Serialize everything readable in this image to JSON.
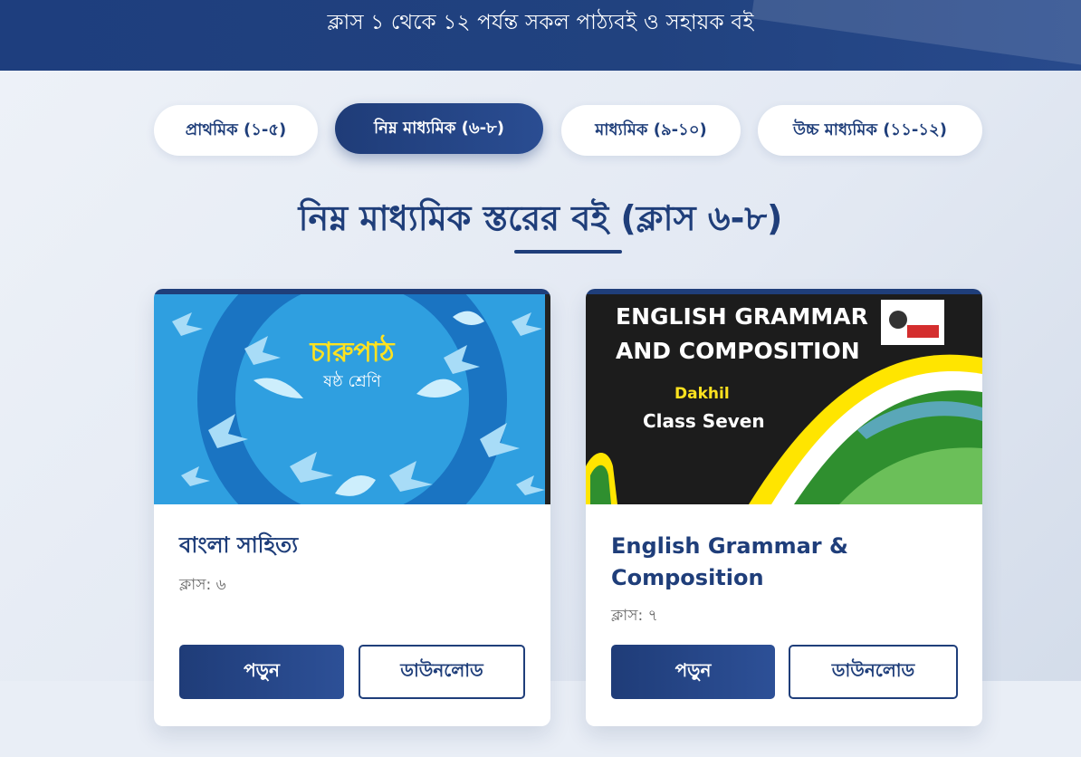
{
  "hero": {
    "subtitle": "ক্লাস ১ থেকে ১২ পর্যন্ত সকল পাঠ্যবই ও সহায়ক বই"
  },
  "tabs": [
    {
      "label": "প্রাথমিক (১-৫)",
      "active": false
    },
    {
      "label": "নিম্ন মাধ্যমিক (৬-৮)",
      "active": true
    },
    {
      "label": "মাধ্যমিক (৯-১০)",
      "active": false
    },
    {
      "label": "উচ্চ মাধ্যমিক (১১-১২)",
      "active": false
    }
  ],
  "section": {
    "title": "নিম্ন মাধ্যমিক স্তরের বই (ক্লাস ৬-৮)"
  },
  "colors": {
    "primary": "#1f3e7a",
    "cover1_bg": "#2f9fe0",
    "cover2_bg": "#1c1c1c",
    "cover2_yellow": "#ffe500"
  },
  "books": [
    {
      "title": "বাংলা সাহিত্য",
      "class_label": "ক্লাস: ৬",
      "cover": {
        "title": "চারুপাঠ",
        "subtitle": "ষষ্ঠ শ্রেণি",
        "art": "white-doves-circle"
      },
      "read_label": "পড়ুন",
      "download_label": "ডাউনলোড"
    },
    {
      "title": "English Grammar & Composition",
      "class_label": "ক্লাস: ৭",
      "cover": {
        "title_line1": "ENGLISH GRAMMAR",
        "title_line2": "AND COMPOSITION",
        "tag": "Dakhil",
        "class": "Class Seven",
        "art": "yellow-green-waves"
      },
      "read_label": "পড়ুন",
      "download_label": "ডাউনলোড"
    }
  ]
}
